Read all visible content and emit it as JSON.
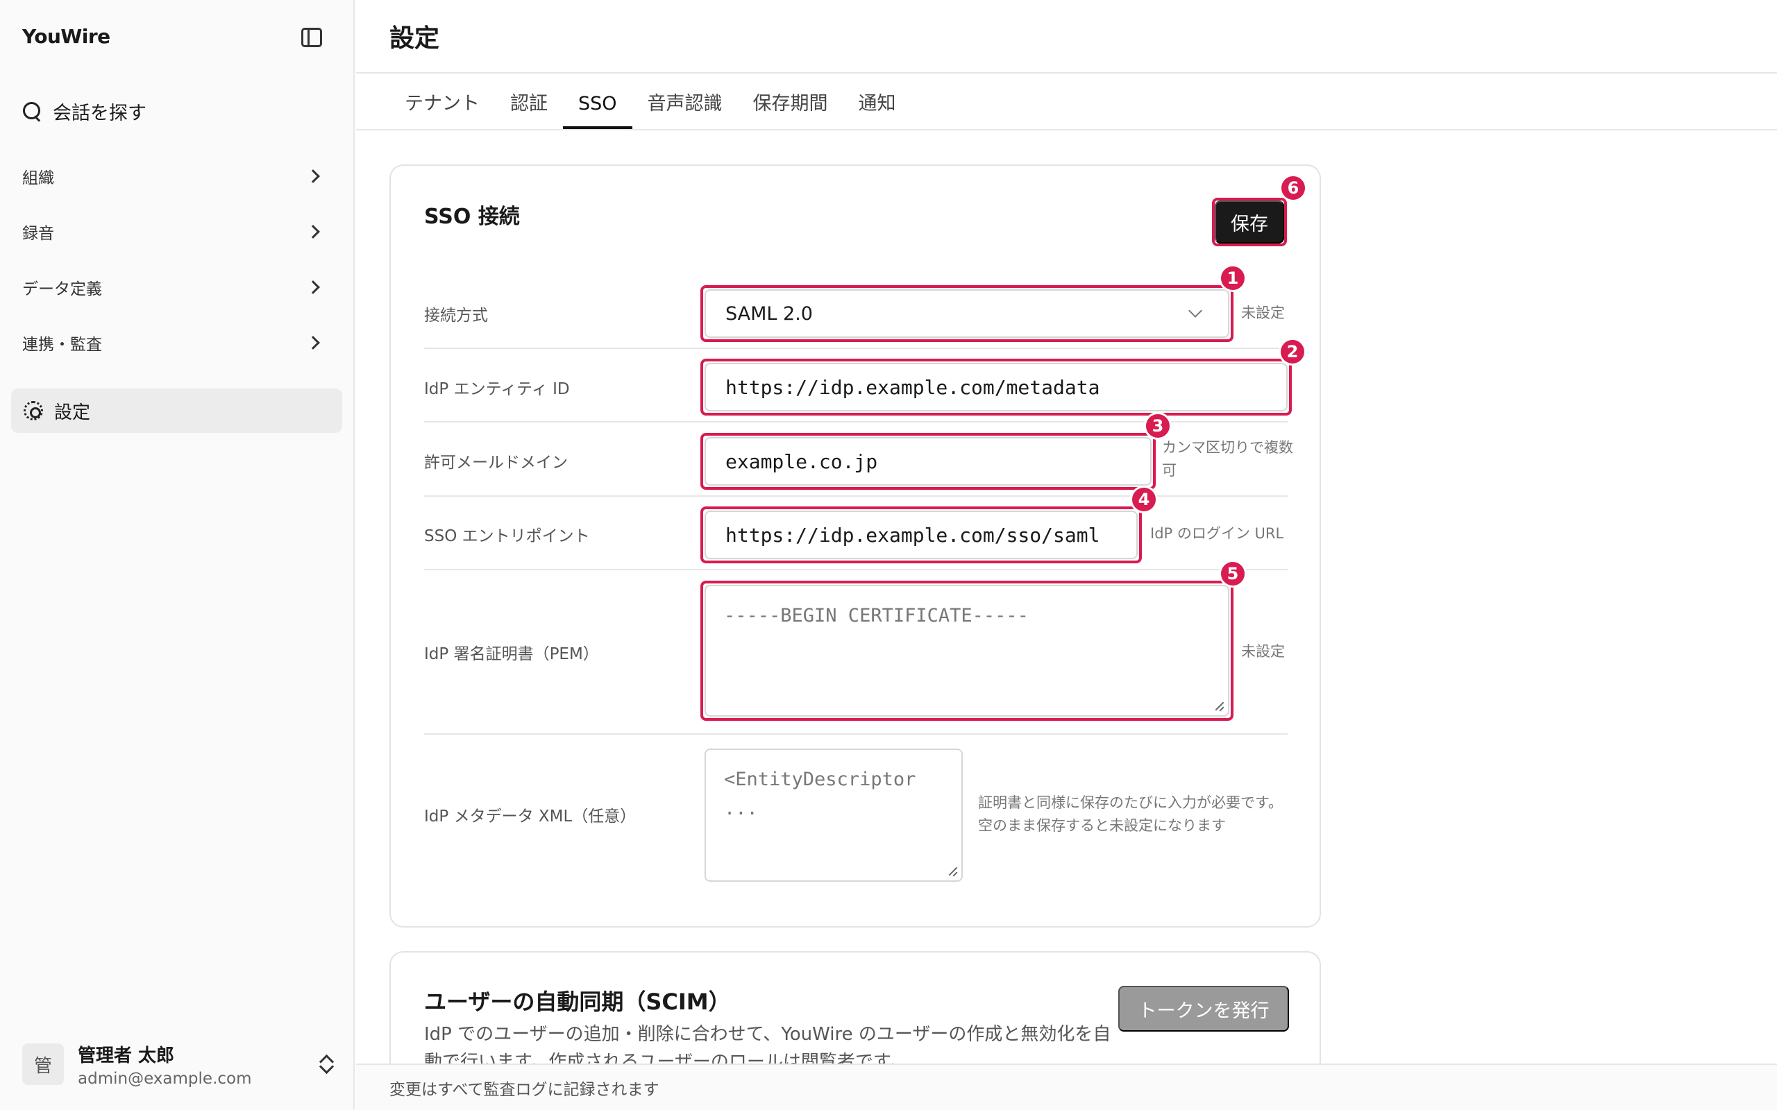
{
  "sidebar": {
    "brand": "YouWire",
    "search_label": "会話を探す",
    "items": [
      {
        "label": "組織"
      },
      {
        "label": "録音"
      },
      {
        "label": "データ定義"
      },
      {
        "label": "連携・監査"
      }
    ],
    "active_label": "設定",
    "user": {
      "avatar": "管",
      "name": "管理者 太郎",
      "email": "admin@example.com"
    }
  },
  "header": {
    "title": "設定",
    "tabs": [
      {
        "label": "テナント"
      },
      {
        "label": "認証"
      },
      {
        "label": "SSO",
        "active": true
      },
      {
        "label": "音声認識"
      },
      {
        "label": "保存期間"
      },
      {
        "label": "通知"
      }
    ]
  },
  "sso": {
    "title": "SSO 接続",
    "save_label": "保存",
    "fields": {
      "method": {
        "label": "接続方式",
        "value": "SAML 2.0",
        "hint": "未設定"
      },
      "entity_id": {
        "label": "IdP エンティティ ID",
        "value": "https://idp.example.com/metadata"
      },
      "domains": {
        "label": "許可メールドメイン",
        "value": "example.co.jp",
        "hint": "カンマ区切りで複数可"
      },
      "entry_point": {
        "label": "SSO エントリポイント",
        "value": "https://idp.example.com/sso/saml",
        "hint": "IdP のログイン URL"
      },
      "cert": {
        "label": "IdP 署名証明書（PEM）",
        "placeholder": "-----BEGIN CERTIFICATE-----",
        "hint": "未設定"
      },
      "metadata": {
        "label": "IdP メタデータ XML（任意）",
        "placeholder_line1": "<EntityDescriptor",
        "placeholder_line2": "...",
        "hint": "証明書と同様に保存のたびに入力が必要です。空のまま保存すると未設定になります"
      }
    },
    "badges": [
      "1",
      "2",
      "3",
      "4",
      "5",
      "6"
    ],
    "highlight_color": "#d81b50"
  },
  "scim": {
    "title": "ユーザーの自動同期（SCIM）",
    "description": "IdP でのユーザーの追加・削除に合わせて、YouWire のユーザーの作成と無効化を自動で行います。作成されるユーザーのロールは閲覧者です。",
    "token_label": "トークンを発行"
  },
  "footer": {
    "text": "変更はすべて監査ログに記録されます"
  }
}
